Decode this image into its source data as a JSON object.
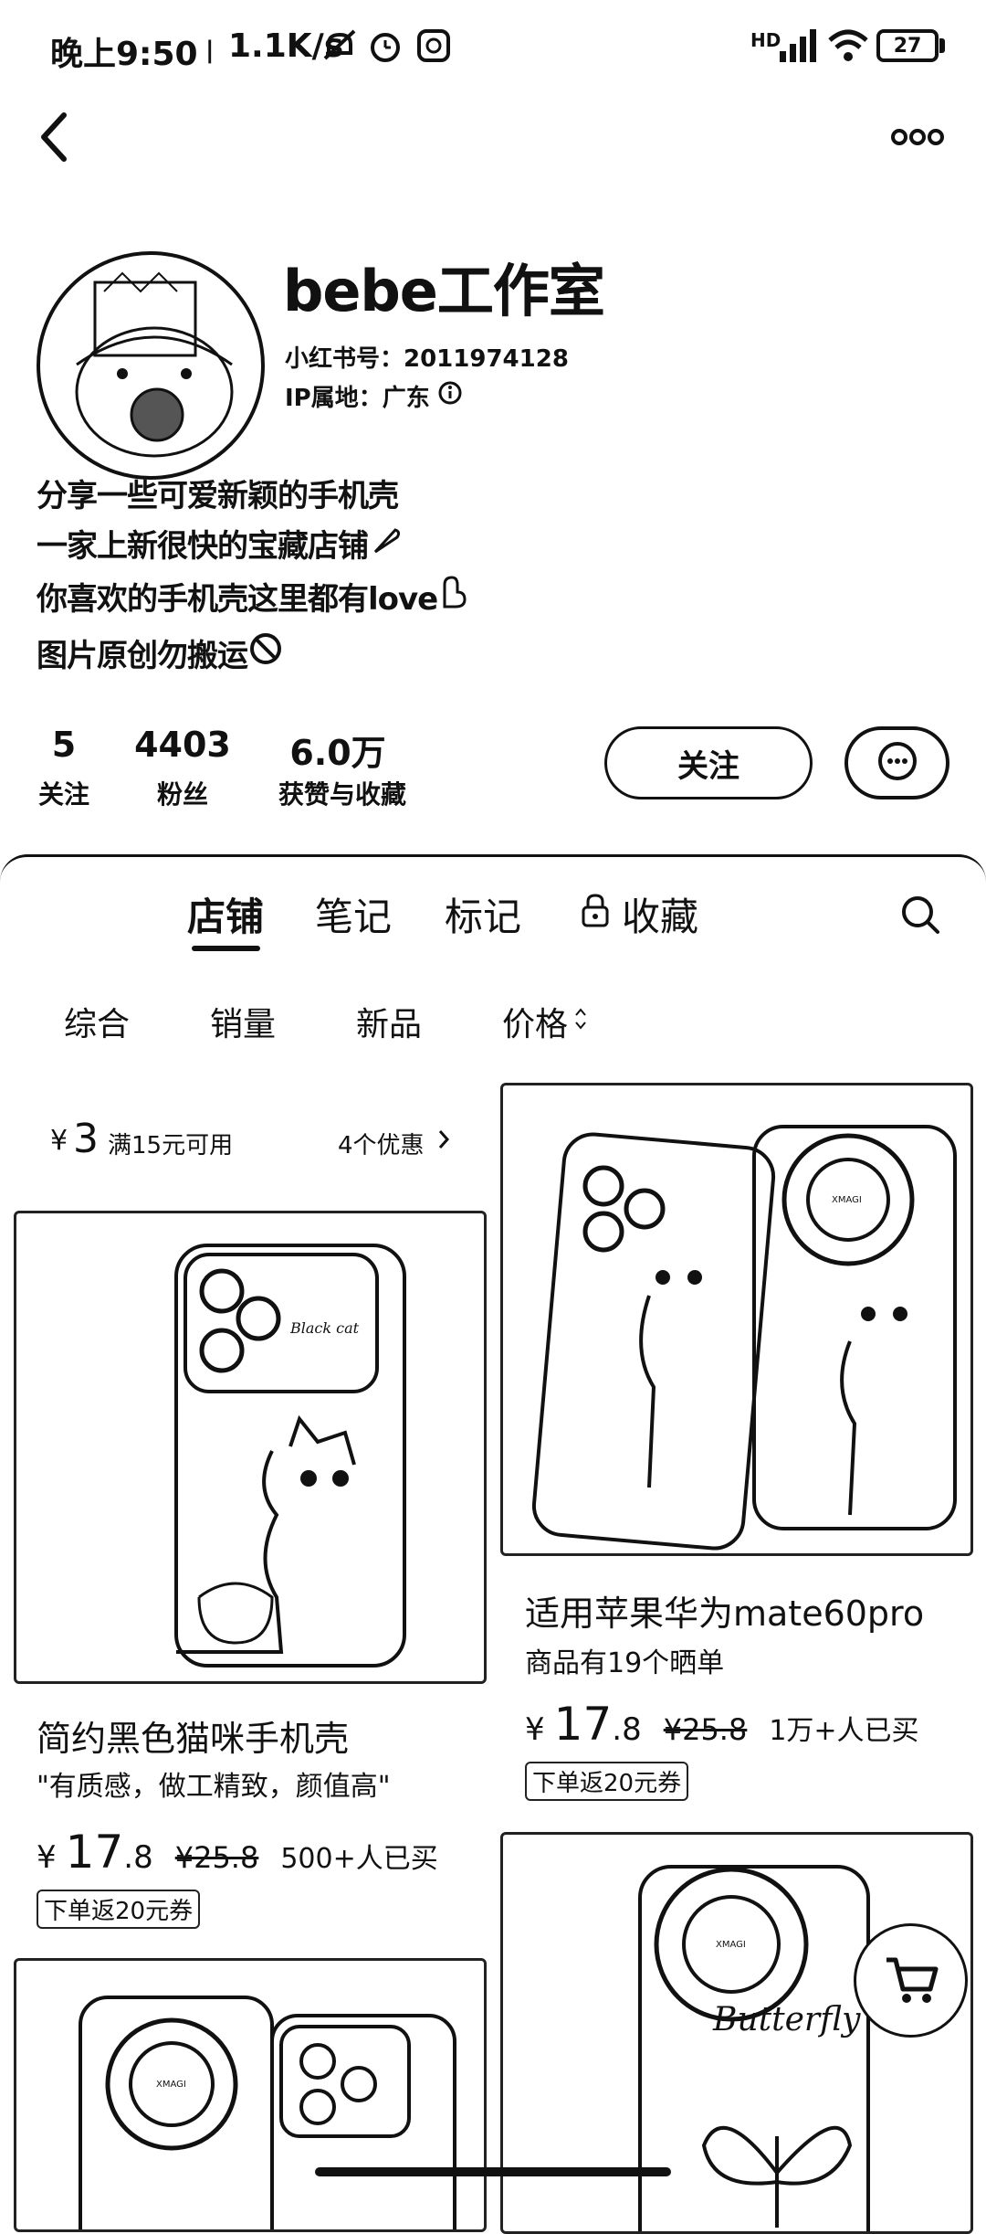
{
  "status_bar": {
    "time": "晚上9:50",
    "net_speed": "1.1K/s",
    "signal": "HD",
    "battery": "27"
  },
  "profile": {
    "name": "bebe工作室",
    "id_label": "小红书号：2011974128",
    "ip_label": "IP属地：广东",
    "bio": [
      "分享一些可爱新颖的手机壳",
      "一家上新很快的宝藏店铺",
      "你喜欢的手机壳这里都有love",
      "图片原创勿搬运"
    ],
    "stats": [
      {
        "value": "5",
        "label": "关注"
      },
      {
        "value": "4403",
        "label": "粉丝"
      },
      {
        "value": "6.0万",
        "label": "获赞与收藏"
      }
    ],
    "follow_label": "关注"
  },
  "tabs": [
    {
      "label": "店铺",
      "active": true
    },
    {
      "label": "笔记",
      "active": false
    },
    {
      "label": "标记",
      "active": false
    },
    {
      "label": "收藏",
      "active": false,
      "icon": "lock-icon"
    }
  ],
  "filters": [
    "综合",
    "销量",
    "新品",
    "价格"
  ],
  "coupon": {
    "symbol": "¥",
    "amount": "3",
    "condition": "满15元可用",
    "more": "4个优惠"
  },
  "products": [
    {
      "title": "简约黑色猫咪手机壳",
      "subtitle": "\"有质感，做工精致，颜值高\"",
      "price_symbol": "¥",
      "price_int": "17",
      "price_dec": ".8",
      "orig_price": "¥25.8",
      "sold": "500+人已买",
      "promo": "下单返20元券"
    },
    {
      "title": "适用苹果华为mate60pro",
      "subtitle": "商品有19个晒单",
      "price_symbol": "¥",
      "price_int": "17",
      "price_dec": ".8",
      "orig_price": "¥25.8",
      "sold": "1万+人已买",
      "promo": "下单返20元券"
    }
  ],
  "image_text": {
    "black_cat": "Black cat",
    "brand": "XMAGI",
    "butterfly": "Butterfly"
  }
}
